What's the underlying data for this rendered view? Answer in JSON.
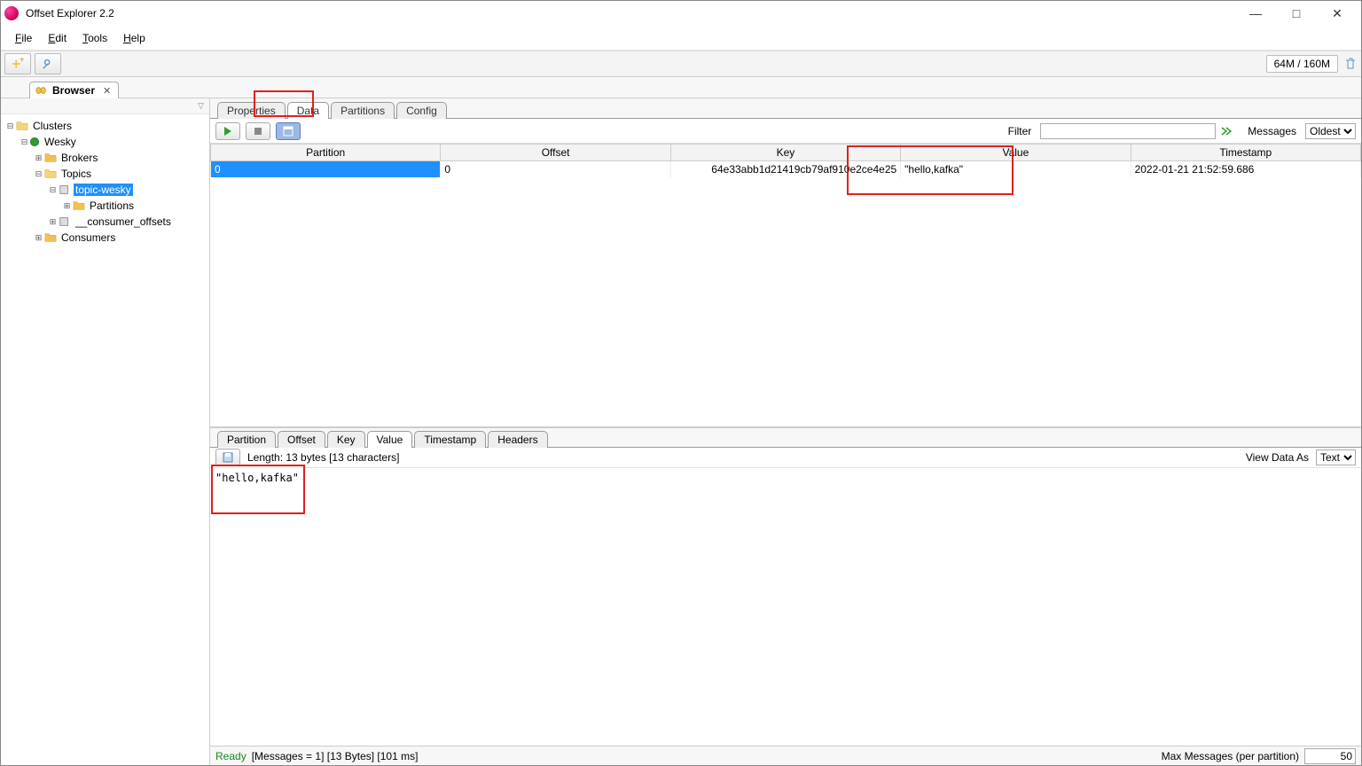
{
  "window": {
    "title": "Offset Explorer  2.2"
  },
  "menu": {
    "file": "File",
    "edit": "Edit",
    "tools": "Tools",
    "help": "Help"
  },
  "memory": {
    "used": "64M",
    "sep": " / ",
    "total": "160M"
  },
  "browser_tab": {
    "label": "Browser"
  },
  "tree": {
    "root": "Clusters",
    "cluster": "Wesky",
    "brokers": "Brokers",
    "topics": "Topics",
    "topic_wesky": "topic-wesky",
    "partitions": "Partitions",
    "consumer_offsets": "__consumer_offsets",
    "consumers": "Consumers"
  },
  "main_tabs": {
    "properties": "Properties",
    "data": "Data",
    "partitions": "Partitions",
    "config": "Config"
  },
  "data_toolbar": {
    "filter_label": "Filter",
    "filter_value": "",
    "messages_label": "Messages",
    "messages_option": "Oldest"
  },
  "columns": {
    "partition": "Partition",
    "offset": "Offset",
    "key": "Key",
    "value": "Value",
    "timestamp": "Timestamp"
  },
  "rows": [
    {
      "partition": "0",
      "offset": "0",
      "key": "64e33abb1d21419cb79af910e2ce4e25",
      "value": "\"hello,kafka\"",
      "timestamp": "2022-01-21 21:52:59.686"
    }
  ],
  "detail_tabs": {
    "partition": "Partition",
    "offset": "Offset",
    "key": "Key",
    "value": "Value",
    "timestamp": "Timestamp",
    "headers": "Headers"
  },
  "detail_bar": {
    "length_label": "Length: 13 bytes [13 characters]",
    "view_as_label": "View Data As",
    "view_as_value": "Text"
  },
  "detail_body": "\"hello,kafka\"",
  "status": {
    "ready": "Ready",
    "info": "[Messages = 1]  [13 Bytes]  [101 ms]",
    "max_label": "Max Messages (per partition)",
    "max_value": "50"
  }
}
